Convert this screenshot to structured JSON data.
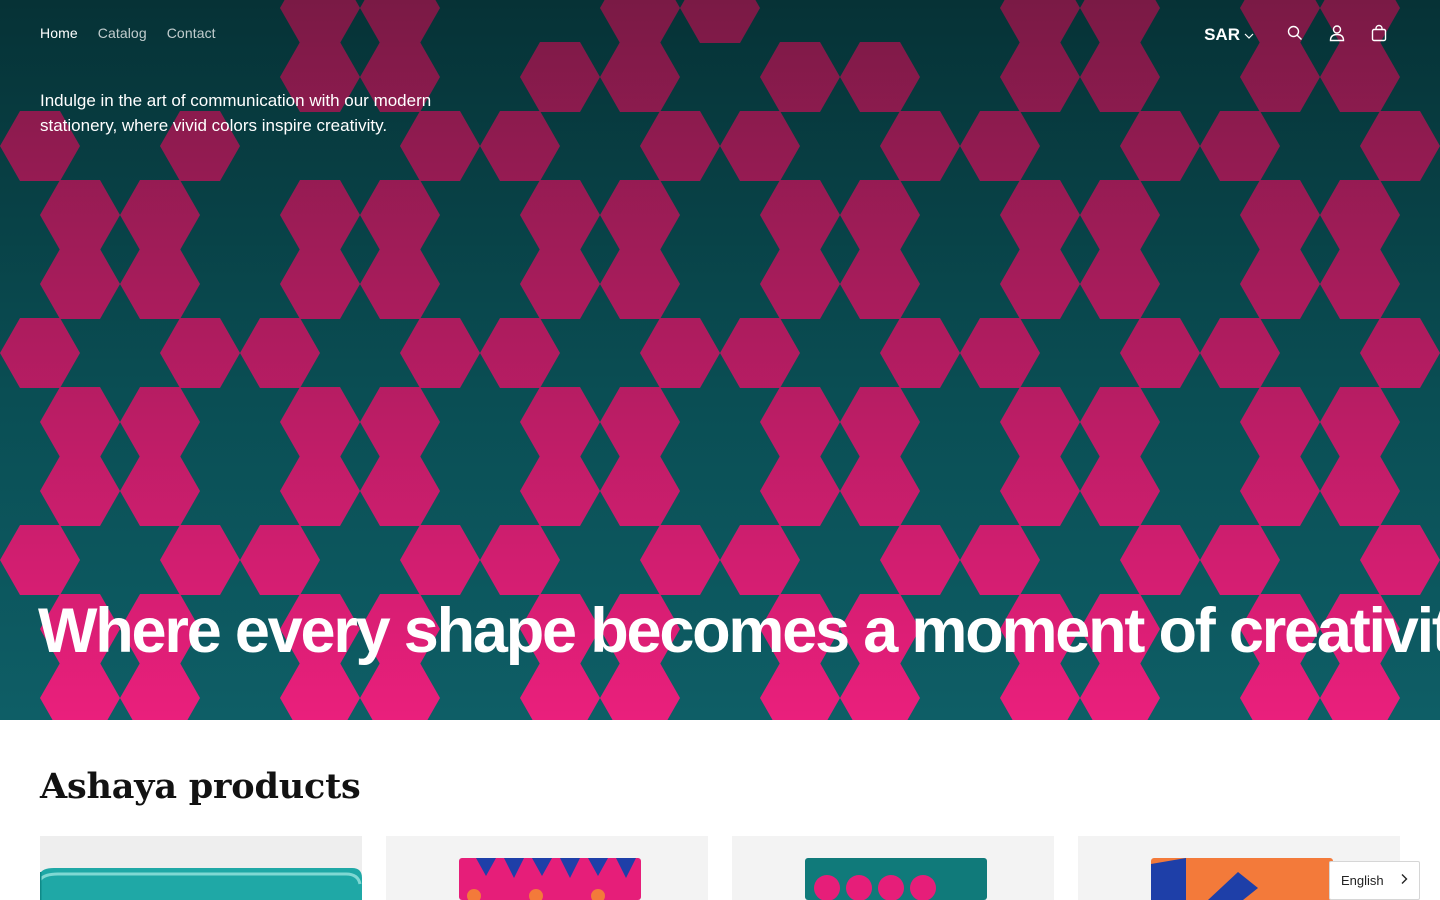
{
  "header": {
    "nav": [
      {
        "label": "Home",
        "active": true
      },
      {
        "label": "Catalog",
        "active": false
      },
      {
        "label": "Contact",
        "active": false
      }
    ],
    "currency": "SAR",
    "icons": [
      "search-icon",
      "account-icon",
      "cart-icon"
    ]
  },
  "hero": {
    "tagline": "Indulge in the art of communication with our modern stationery, where vivid colors inspire creativity.",
    "title": "Where every shape becomes a moment of creativity."
  },
  "products": {
    "heading": "Ashaya products",
    "items": [
      {
        "image": "teal-pouch"
      },
      {
        "image": "pink-star-notebook"
      },
      {
        "image": "teal-flower-notebook"
      },
      {
        "image": "orange-blue-notebook"
      }
    ]
  },
  "language": {
    "selected": "English"
  },
  "colors": {
    "hero_top": "#063236",
    "hero_bottom": "#0e5e66",
    "hexagon_pink_top": "#7a1a45",
    "hexagon_pink_bottom": "#ea1f7c",
    "text_dark": "#121212"
  }
}
